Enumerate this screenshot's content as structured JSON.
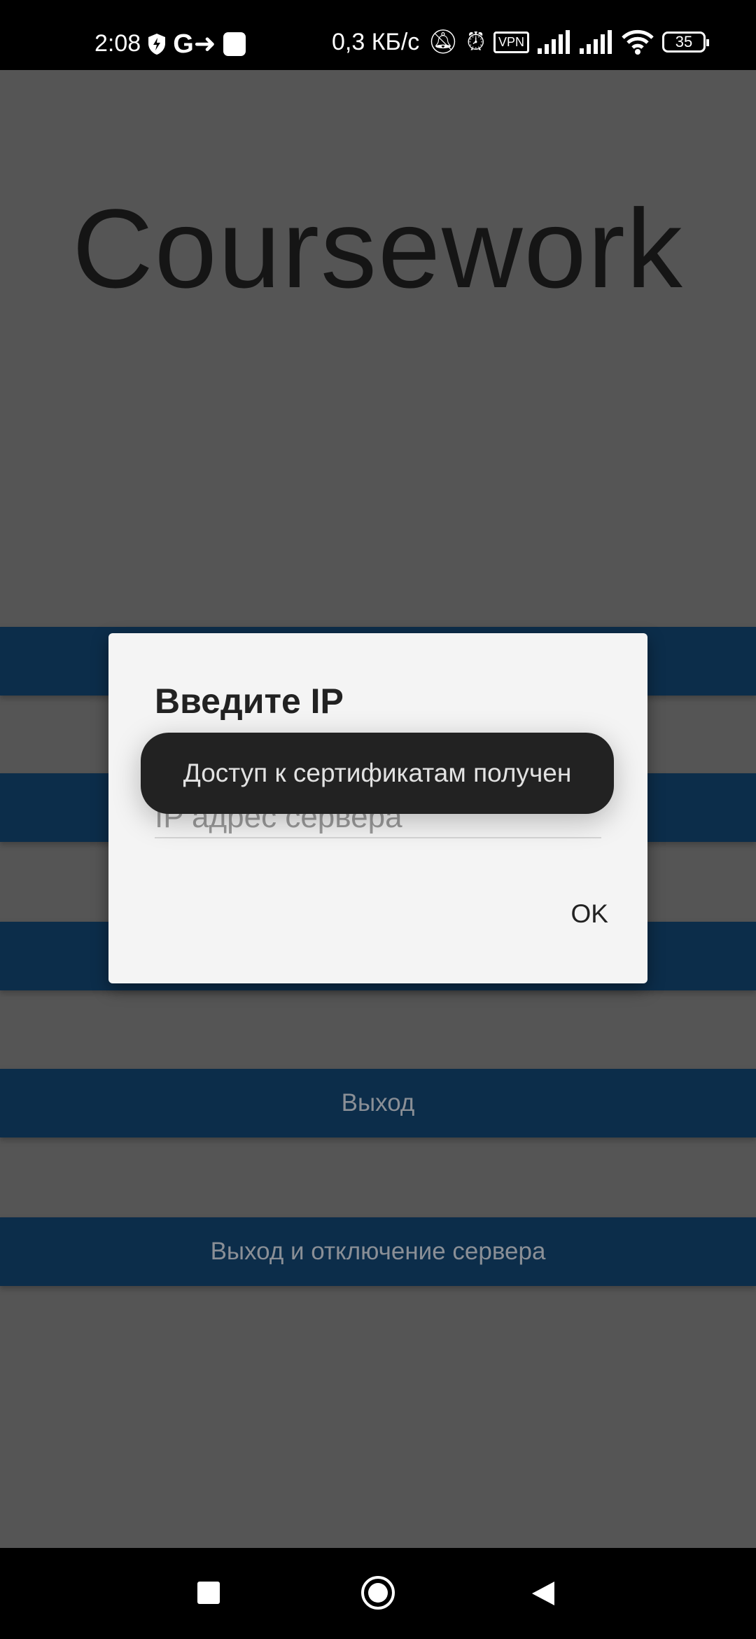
{
  "status_bar": {
    "time": "2:08",
    "net_speed": "0,3 КБ/с",
    "vpn": "VPN",
    "battery": "35",
    "icons": [
      "shield-bolt-icon",
      "g-arrow-icon",
      "notification-square-icon",
      "bell-off-icon",
      "alarm-icon",
      "vpn-icon",
      "signal-icon",
      "signal-icon",
      "wifi-icon",
      "battery-icon"
    ]
  },
  "app": {
    "title": "Coursework",
    "buttons": [
      {
        "label": ""
      },
      {
        "label": ""
      },
      {
        "label": ""
      },
      {
        "label": "Выход"
      },
      {
        "label": "Выход и отключение сервера"
      }
    ]
  },
  "dialog": {
    "title": "Введите IP",
    "input_placeholder": "IP адрес сервера",
    "input_value": "",
    "ok_label": "OK"
  },
  "toast": {
    "text": "Доступ к сертификатам получен"
  },
  "colors": {
    "button_bg": "#0c2d4a",
    "dialog_bg": "#f4f4f4",
    "toast_bg": "#222222"
  }
}
